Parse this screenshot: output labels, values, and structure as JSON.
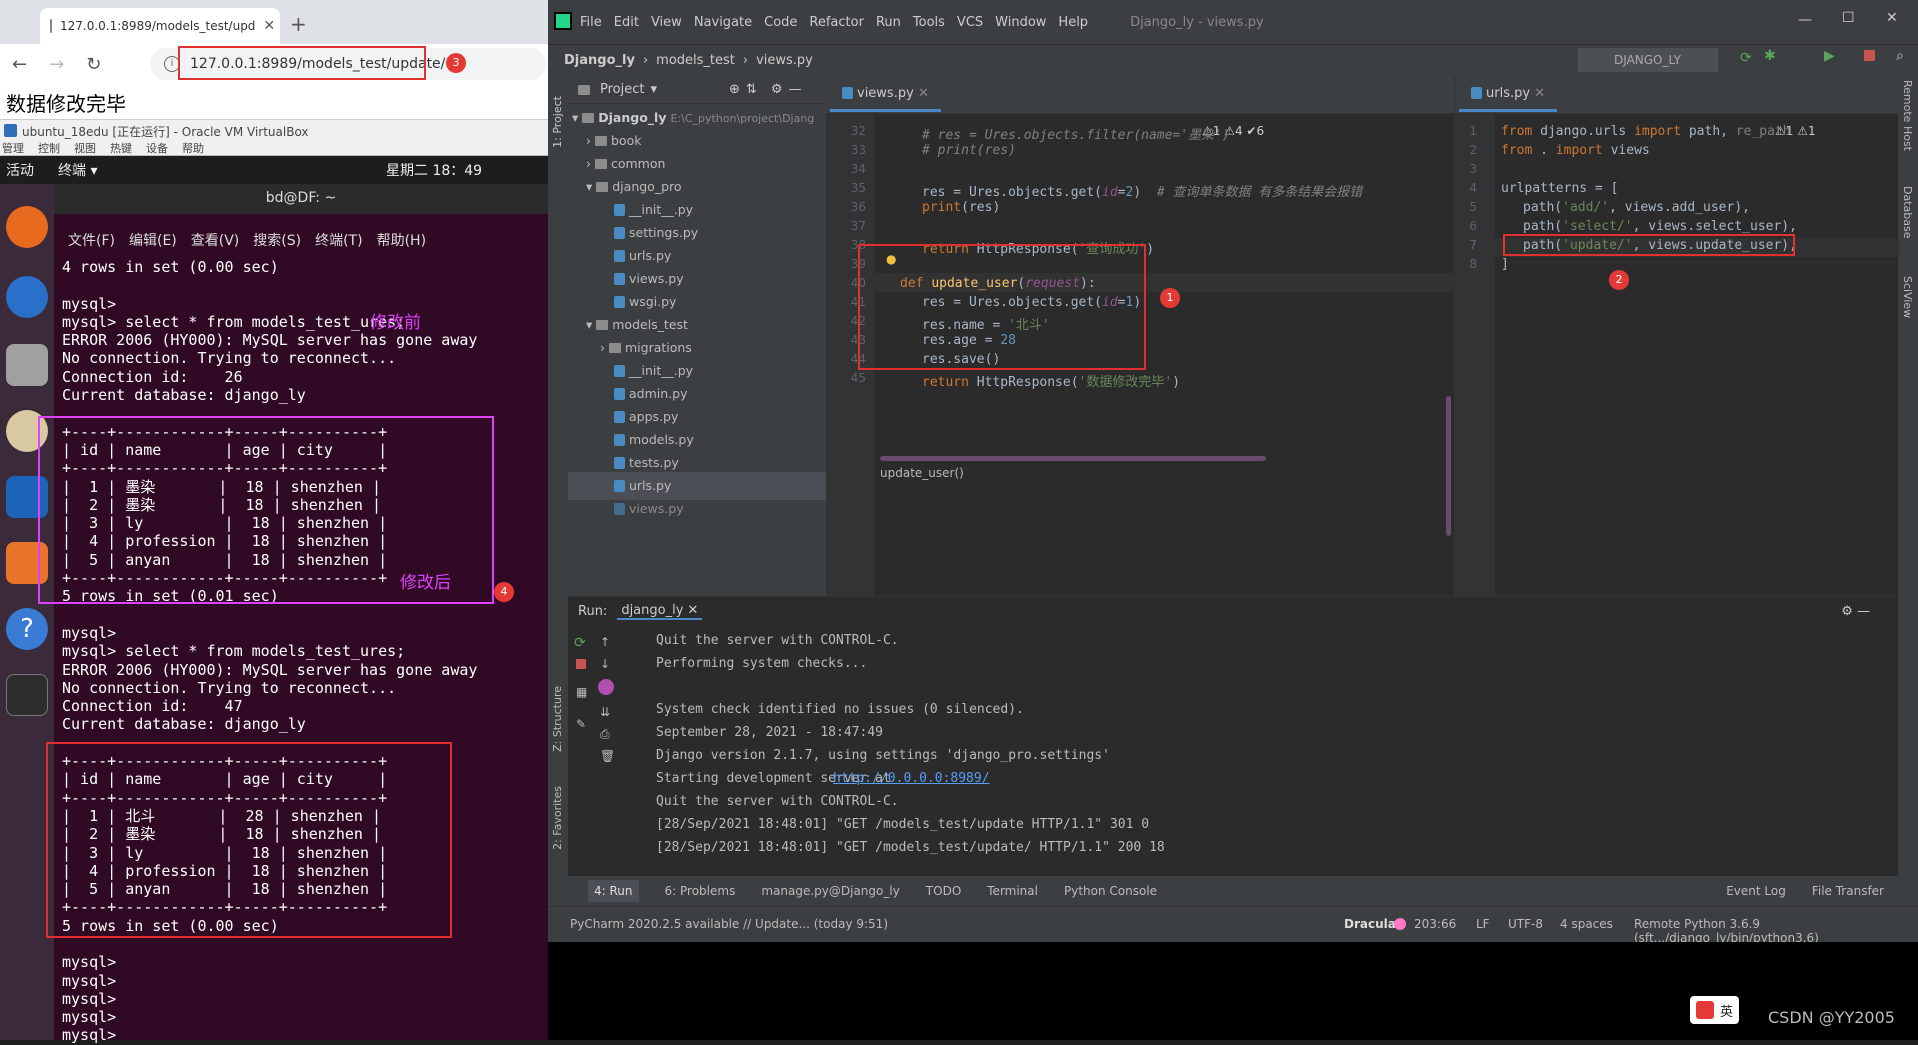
{
  "browser": {
    "tab_title": "127.0.0.1:8989/models_test/upd",
    "url": "127.0.0.1:8989/models_test/update/",
    "page_text": "数据修改完毕",
    "badge": "3"
  },
  "vbox": {
    "title": "ubuntu_18edu [正在运行] - Oracle VM VirtualBox",
    "menu": [
      "管理",
      "控制",
      "视图",
      "热键",
      "设备",
      "帮助"
    ]
  },
  "ubuntu": {
    "activities": "活动",
    "app": "终端 ▾",
    "clock": "星期二 18：49"
  },
  "terminal": {
    "title": "bd@DF: ~",
    "menu": [
      "文件(F)",
      "编辑(E)",
      "查看(V)",
      "搜索(S)",
      "终端(T)",
      "帮助(H)"
    ],
    "lines": "4 rows in set (0.00 sec)\n\nmysql>\nmysql> select * from models_test_ures;\nERROR 2006 (HY000): MySQL server has gone away\nNo connection. Trying to reconnect...\nConnection id:    26\nCurrent database: django_ly\n\n+----+------------+-----+----------+\n| id | name       | age | city     |\n+----+------------+-----+----------+\n|  1 | 墨染       |  18 | shenzhen |\n|  2 | 墨染       |  18 | shenzhen |\n|  3 | ly         |  18 | shenzhen |\n|  4 | profession |  18 | shenzhen |\n|  5 | anyan      |  18 | shenzhen |\n+----+------------+-----+----------+\n5 rows in set (0.01 sec)\n\nmysql>\nmysql> select * from models_test_ures;\nERROR 2006 (HY000): MySQL server has gone away\nNo connection. Trying to reconnect...\nConnection id:    47\nCurrent database: django_ly\n\n+----+------------+-----+----------+\n| id | name       | age | city     |\n+----+------------+-----+----------+\n|  1 | 北斗       |  28 | shenzhen |\n|  2 | 墨染       |  18 | shenzhen |\n|  3 | ly         |  18 | shenzhen |\n|  4 | profession |  18 | shenzhen |\n|  5 | anyan      |  18 | shenzhen |\n+----+------------+-----+----------+\n5 rows in set (0.00 sec)\n\nmysql>\nmysql>\nmysql>\nmysql>\nmysql>",
    "before_label": "修改前",
    "after_label": "修改后",
    "badge": "4"
  },
  "pycharm": {
    "menu": [
      "File",
      "Edit",
      "View",
      "Navigate",
      "Code",
      "Refactor",
      "Run",
      "Tools",
      "VCS",
      "Window",
      "Help"
    ],
    "window_title": "Django_ly - views.py",
    "crumbs": [
      "Django_ly",
      "models_test",
      "views.py"
    ],
    "run_config": "DJANGO_LY",
    "project_header": "Project",
    "tree": [
      {
        "label": "Django_ly",
        "sub": "E:\\C_python\\project\\Djang",
        "kind": "folder"
      },
      {
        "label": "book",
        "kind": "folder"
      },
      {
        "label": "common",
        "kind": "folder"
      },
      {
        "label": "django_pro",
        "kind": "folder"
      },
      {
        "label": "__init__.py",
        "kind": "py"
      },
      {
        "label": "settings.py",
        "kind": "py"
      },
      {
        "label": "urls.py",
        "kind": "py"
      },
      {
        "label": "views.py",
        "kind": "py"
      },
      {
        "label": "wsgi.py",
        "kind": "py"
      },
      {
        "label": "models_test",
        "kind": "folder"
      },
      {
        "label": "migrations",
        "kind": "folder"
      },
      {
        "label": "__init__.py",
        "kind": "py"
      },
      {
        "label": "admin.py",
        "kind": "py"
      },
      {
        "label": "apps.py",
        "kind": "py"
      },
      {
        "label": "models.py",
        "kind": "py"
      },
      {
        "label": "tests.py",
        "kind": "py"
      },
      {
        "label": "urls.py",
        "kind": "py"
      },
      {
        "label": "views.py",
        "kind": "py"
      }
    ],
    "editor1": {
      "tab": "views.py",
      "warnings": "⚠1  ⚠4  ✔6",
      "lines": [
        "32",
        "33",
        "34",
        "35",
        "36",
        "37",
        "38",
        "39",
        "40",
        "41",
        "42",
        "43",
        "44",
        "45"
      ],
      "breadcrumb": "update_user()",
      "badge": "1"
    },
    "editor2": {
      "tab": "urls.py",
      "warnings": "⚠1  ⚠1",
      "lines": [
        "1",
        "2",
        "3",
        "4",
        "5",
        "6",
        "7",
        "8"
      ],
      "badge": "2"
    },
    "run": {
      "label": "Run:",
      "tab": "django_ly",
      "output": "Quit the server with CONTROL-C.\nPerforming system checks...\n\nSystem check identified no issues (0 silenced).\nSeptember 28, 2021 - 18:47:49\nDjango version 2.1.7, using settings 'django_pro.settings'\nStarting development server at \nQuit the server with CONTROL-C.\n",
      "link": "http://0.0.0.0:8989/",
      "log1": "[28/Sep/2021 18:48:01] \"GET /models_test/update HTTP/1.1\" 301 0",
      "log2": "[28/Sep/2021 18:48:01] \"GET /models_test/update/ HTTP/1.1\" 200 18"
    },
    "bottom_tabs": [
      "4: Run",
      "6: Problems",
      "manage.py@Django_ly",
      "TODO",
      "Terminal",
      "Python Console"
    ],
    "event_log": "Event Log",
    "file_transfer": "File Transfer",
    "status_left": "PyCharm 2020.2.5 available // Update... (today 9:51)",
    "status_right": [
      "Dracula",
      "203:66",
      "LF",
      "UTF-8",
      "4 spaces",
      "Remote Python 3.6.9 (sft.../django_ly/bin/python3.6)"
    ],
    "side_left": [
      "1: Project",
      "Z: Structure",
      "2: Favorites"
    ],
    "side_right": [
      "Remote Host",
      "Database",
      "SciView"
    ]
  },
  "taskbar": {
    "ime": "英",
    "watermark": "CSDN @YY2005"
  }
}
